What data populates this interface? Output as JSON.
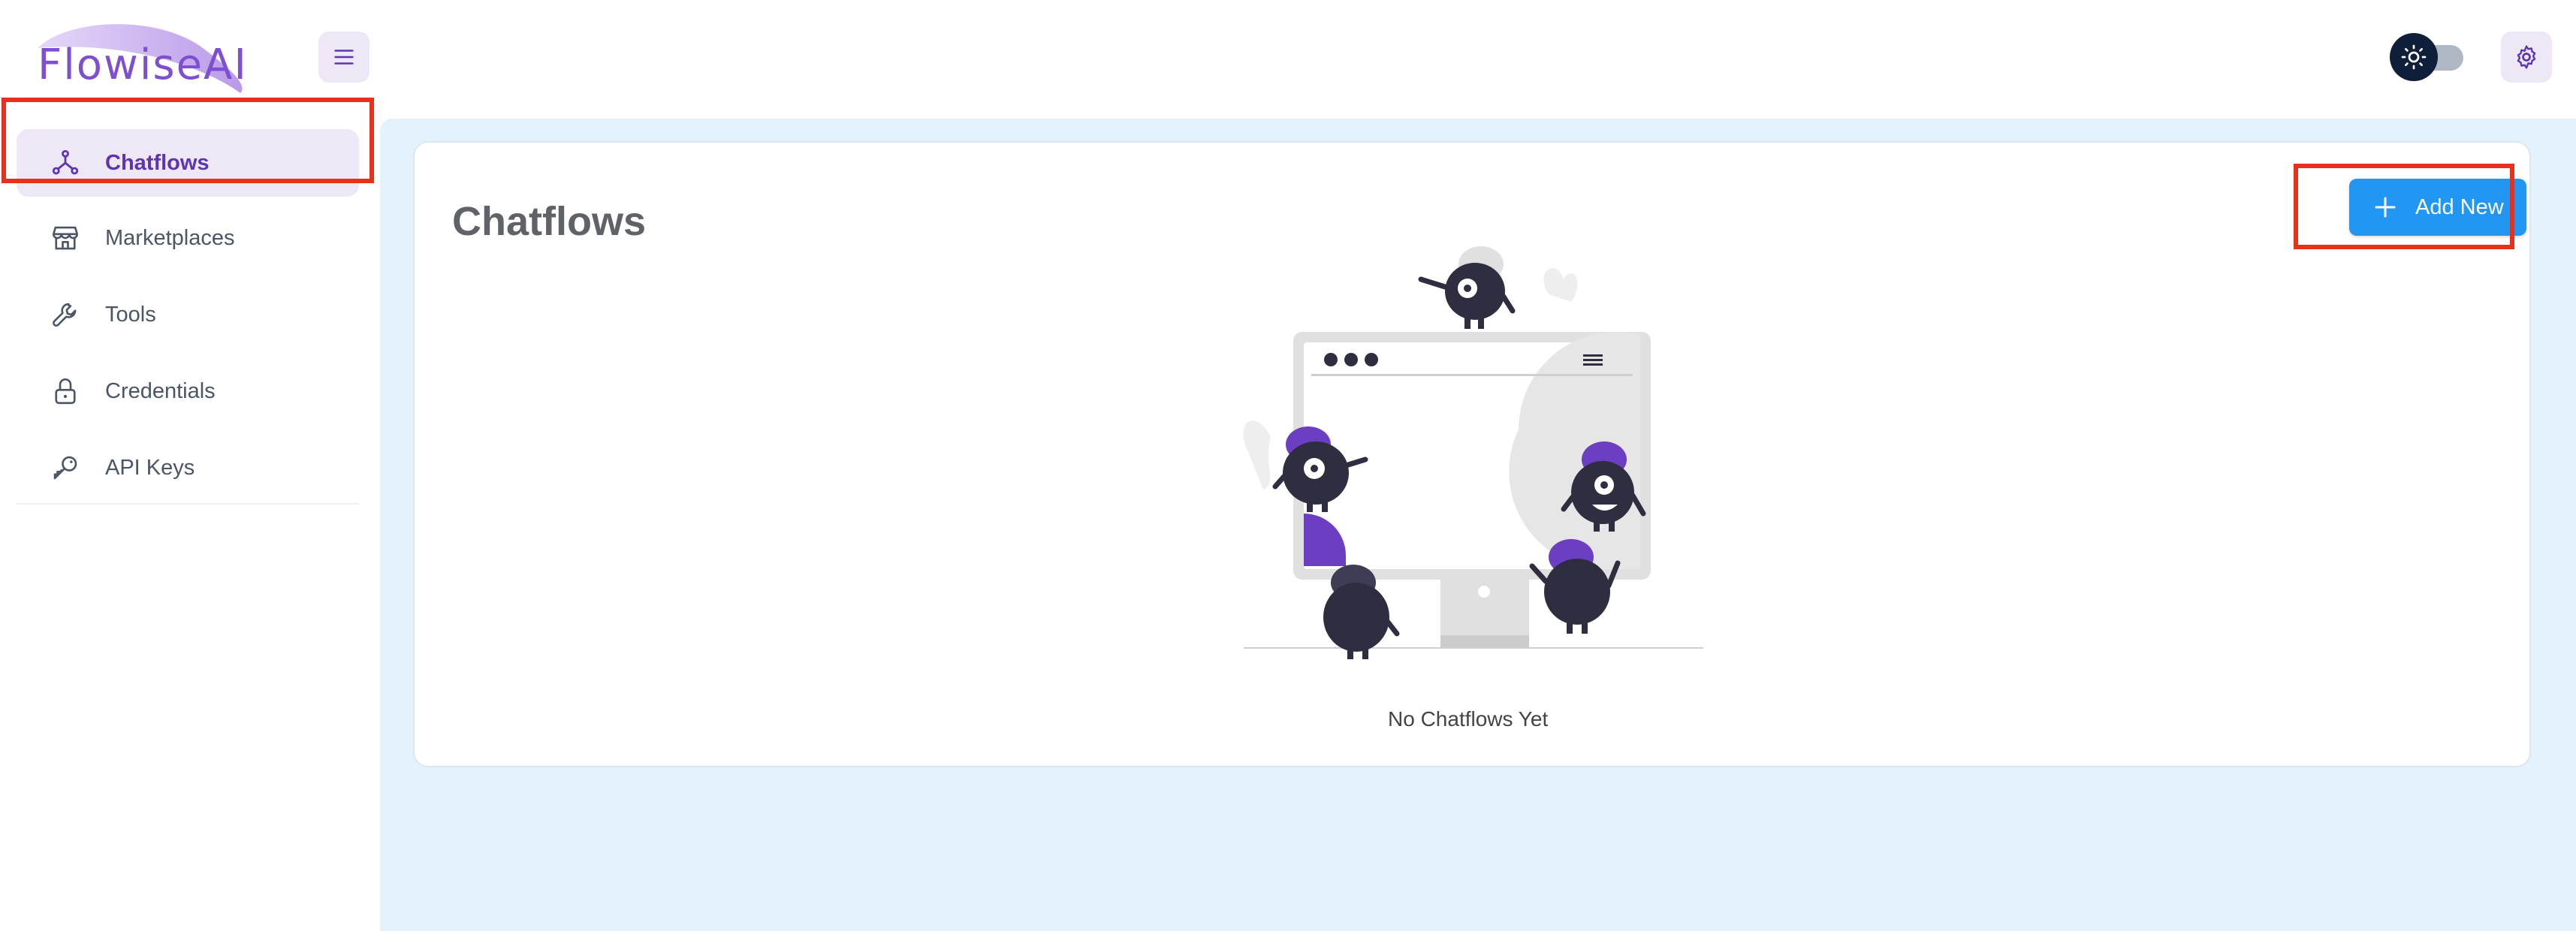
{
  "app": {
    "logo_text": "FlowiseAI"
  },
  "header": {
    "menu_icon": "hamburger-icon",
    "theme_icon": "sun-icon",
    "settings_icon": "gear-icon"
  },
  "sidebar": {
    "items": [
      {
        "label": "Chatflows",
        "icon": "network-icon",
        "active": true
      },
      {
        "label": "Marketplaces",
        "icon": "store-icon",
        "active": false
      },
      {
        "label": "Tools",
        "icon": "wrench-icon",
        "active": false
      },
      {
        "label": "Credentials",
        "icon": "lock-icon",
        "active": false
      },
      {
        "label": "API Keys",
        "icon": "key-icon",
        "active": false
      }
    ]
  },
  "main": {
    "title": "Chatflows",
    "add_button_label": "Add New",
    "empty_state_text": "No Chatflows Yet"
  },
  "colors": {
    "accent": "#5e35b1",
    "primary_button": "#2196f3",
    "main_background": "#e3f2fd",
    "highlight_box": "#e8301c"
  }
}
